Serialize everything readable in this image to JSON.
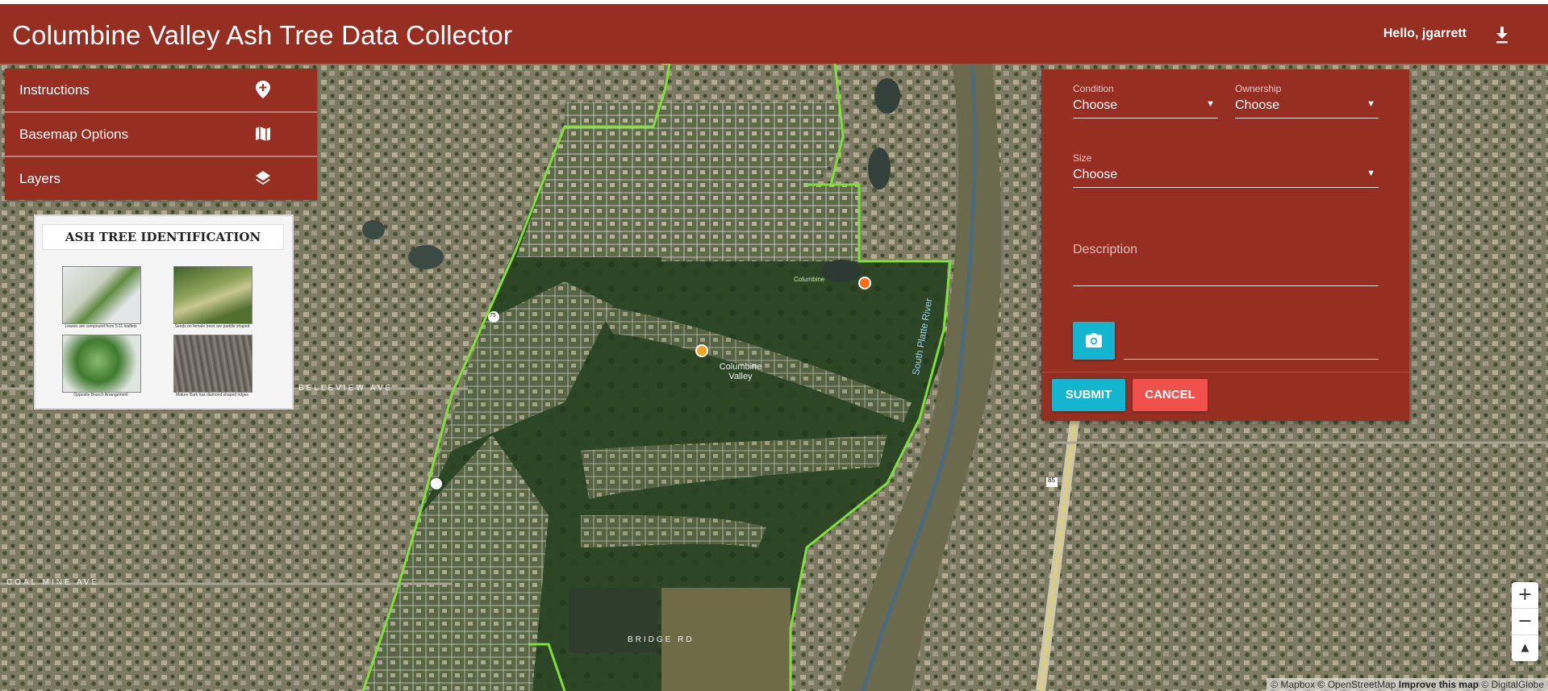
{
  "app": {
    "title": "Columbine Valley Ash Tree Data Collector",
    "greeting": "Hello, jgarrett",
    "download_icon": "download-icon",
    "brand_color": "#972e22"
  },
  "menu": {
    "items": [
      {
        "label": "Instructions",
        "icon": "add-location-icon"
      },
      {
        "label": "Basemap Options",
        "icon": "map-icon"
      },
      {
        "label": "Layers",
        "icon": "layers-icon"
      }
    ]
  },
  "id_card": {
    "title": "ASH TREE IDENTIFICATION",
    "captions": [
      "Leaves are compound from 5-11 leaflets",
      "Seeds on female trees are paddle shaped",
      "Opposite Branch Arrangement",
      "Mature Bark has diamond shaped ridges"
    ]
  },
  "form": {
    "condition": {
      "label": "Condition",
      "value": "Choose"
    },
    "ownership": {
      "label": "Ownership",
      "value": "Choose"
    },
    "size": {
      "label": "Size",
      "value": "Choose"
    },
    "description": {
      "placeholder": "Description"
    },
    "camera_icon": "camera-icon",
    "submit_label": "SUBMIT",
    "cancel_label": "CANCEL",
    "submit_color": "#13b5cf",
    "cancel_color": "#f0514d"
  },
  "map": {
    "place_label": "Columbine Valley",
    "lake_label": "Columbine",
    "river_label": "South Platte River",
    "route_85": "85",
    "route_small": "75",
    "street_labels": [
      "BELLEVIEW AVE",
      "COAL MINE AVE",
      "BRIDGE RD"
    ],
    "boundary_color": "#7fe03a",
    "marker_colors": [
      "#ff6a13",
      "#f6a324"
    ]
  },
  "zoom": {
    "in": "+",
    "out": "−",
    "compass": "▲"
  },
  "attribution": {
    "mapbox": "© Mapbox",
    "osm": "© OpenStreetMap",
    "improve": "Improve this map",
    "dg": "© DigitalGlobe"
  }
}
